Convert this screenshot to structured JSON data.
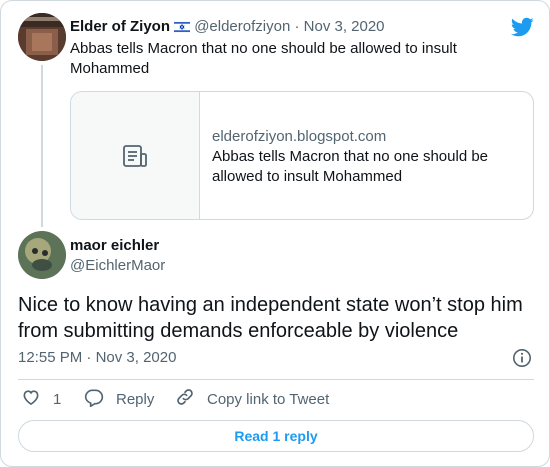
{
  "parent_tweet": {
    "author_name": "Elder of Ziyon",
    "flag_icon": "israel-flag-icon",
    "handle": "@elderofziyon",
    "separator": "·",
    "date": "Nov 3, 2020",
    "text": "Abbas tells Macron that no one should be allowed to insult Mohammed",
    "link_card": {
      "icon": "document-icon",
      "domain": "elderofziyon.blogspot.com",
      "title": "Abbas tells Macron that no one should be allowed to insult Mohammed"
    }
  },
  "brand": {
    "icon": "twitter-bird-icon",
    "color": "#1d9bf0"
  },
  "main_tweet": {
    "author_name": "maor eichler",
    "handle": "@EichlerMaor",
    "text": "Nice to know having an independent state won’t stop him from submitting demands enforceable by violence",
    "time": "12:55 PM",
    "separator": "·",
    "date": "Nov 3, 2020",
    "info_icon": "info-icon"
  },
  "actions": {
    "like_count": "1",
    "reply_label": "Reply",
    "copy_label": "Copy link to Tweet"
  },
  "read_replies_label": "Read 1 reply",
  "colors": {
    "text": "#0f1419",
    "muted": "#536471",
    "border": "#cfd9de",
    "accent": "#1d9bf0"
  }
}
